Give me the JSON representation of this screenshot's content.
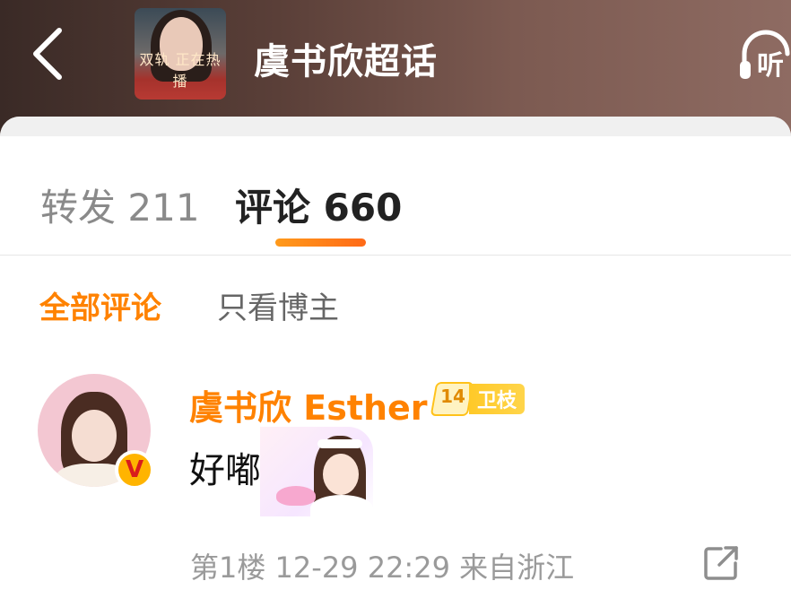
{
  "header": {
    "back_icon": "back-chevron-icon",
    "cover_caption": "双轨 正在热播",
    "title": "虞书欣超话",
    "listen_label": "听"
  },
  "tabs": [
    {
      "label": "转发",
      "count": "211",
      "active": false
    },
    {
      "label": "评论",
      "count": "660",
      "active": true
    }
  ],
  "filters": {
    "all": "全部评论",
    "author_only": "只看博主",
    "active": "all"
  },
  "comment": {
    "username": "虞书欣 Esther",
    "verified_icon": "verified-v-icon",
    "fan_badge": {
      "level": "14",
      "label": "卫枝"
    },
    "text": "好嘟",
    "floor": "第1楼",
    "datetime": "12-29 22:29",
    "location": "来自浙江",
    "share_icon": "share-icon"
  },
  "colors": {
    "accent_orange": "#ff8200",
    "underline_gradient": [
      "#ff9a1a",
      "#ff6a18"
    ],
    "badge_gold": "#ffc21a",
    "header_bg": "#5a3f38"
  }
}
